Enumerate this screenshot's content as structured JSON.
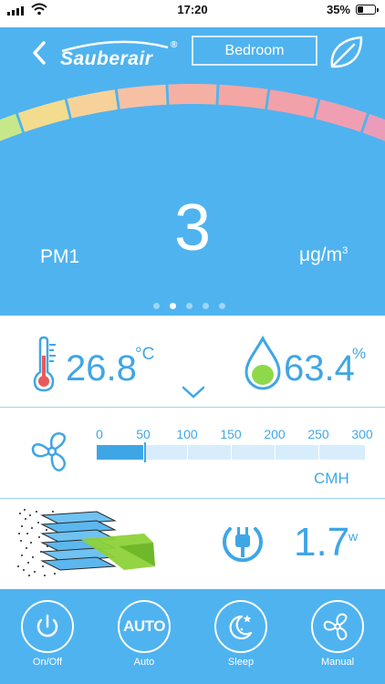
{
  "status": {
    "time": "17:20",
    "battery": "35%",
    "battery_level": 0.35
  },
  "header": {
    "brand": "Sauberair",
    "brand_mark": "®",
    "room": "Bedroom",
    "back_icon": "chevron-left-icon",
    "mode_icon": "leaf-icon"
  },
  "reading": {
    "value": "3",
    "label": "PM1",
    "unit": "μg/m",
    "unit_exp": "3",
    "page_count": 5,
    "active_page": 1
  },
  "gauge": {
    "segment_colors": [
      "#2a3fd8",
      "#3cc8f5",
      "#c7e88a",
      "#f3dc8e",
      "#f6d29a",
      "#f7c0a4",
      "#f5b0a4",
      "#f3a6a4",
      "#f1a1a9",
      "#ef9fb1",
      "#ea9cba",
      "#df9fca",
      "#d8a8d8"
    ],
    "needle_level": 0.02,
    "colors": {
      "low": "#1a3ad8",
      "mid": "#f3dc8e",
      "high": "#d8a8d8"
    }
  },
  "environment": {
    "temperature": "26.8",
    "temperature_unit": "°C",
    "humidity": "63.4",
    "humidity_unit": "%",
    "expand_icon": "chevron-down-icon"
  },
  "airflow": {
    "scale": [
      "0",
      "50",
      "100",
      "150",
      "200",
      "250",
      "300"
    ],
    "value": 50,
    "max": 300,
    "unit": "CMH",
    "icon": "fan-icon"
  },
  "power": {
    "value": "1.7",
    "unit": "w",
    "icon": "power-plug-icon"
  },
  "controls": [
    {
      "label": "On/Off",
      "icon": "power-icon"
    },
    {
      "label": "Auto",
      "icon": "auto-icon",
      "text": "AUTO"
    },
    {
      "label": "Sleep",
      "icon": "moon-stars-icon"
    },
    {
      "label": "Manual",
      "icon": "fan-icon"
    }
  ],
  "colors": {
    "accent": "#4fb3f0",
    "text_accent": "#3fa6e6",
    "bar_track": "#d7edfb"
  }
}
